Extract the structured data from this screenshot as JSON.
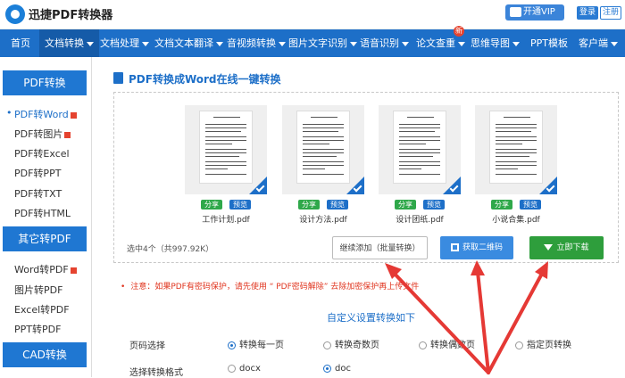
{
  "header": {
    "brand": "迅捷PDF转换器",
    "vip_label": "开通VIP",
    "login_label": "登录",
    "register_label": "注册"
  },
  "nav": {
    "items": [
      {
        "label": "首页",
        "dropdown": false
      },
      {
        "label": "文档转换",
        "dropdown": true,
        "active": true
      },
      {
        "label": "文档处理",
        "dropdown": true
      },
      {
        "label": "文档文本翻译",
        "dropdown": true
      },
      {
        "label": "音视频转换",
        "dropdown": true
      },
      {
        "label": "图片文字识别",
        "dropdown": true
      },
      {
        "label": "语音识别",
        "dropdown": true
      },
      {
        "label": "论文查重",
        "dropdown": true
      },
      {
        "label": "思维导图",
        "dropdown": true
      },
      {
        "label": "PPT模板",
        "dropdown": false
      },
      {
        "label": "客户端",
        "dropdown": true
      }
    ],
    "new_badge": "新"
  },
  "sidebar": {
    "groups": [
      {
        "title": "PDF转换",
        "items": [
          "PDF转Word",
          "PDF转图片",
          "PDF转Excel",
          "PDF转PPT",
          "PDF转TXT",
          "PDF转HTML"
        ]
      },
      {
        "title": "其它转PDF",
        "items": [
          "Word转PDF",
          "图片转PDF",
          "Excel转PDF",
          "PPT转PDF"
        ]
      },
      {
        "title": "CAD转换",
        "items": []
      }
    ]
  },
  "main": {
    "title": "PDF转换成Word在线一键转换",
    "files": [
      {
        "name": "工作计划.pdf",
        "share": "分享",
        "preview": "预览"
      },
      {
        "name": "设计方法.pdf",
        "share": "分享",
        "preview": "预览"
      },
      {
        "name": "设计团纸.pdf",
        "share": "分享",
        "preview": "预览"
      },
      {
        "name": "小说合集.pdf",
        "share": "分享",
        "preview": "预览"
      }
    ],
    "stats": "选中4个（共997.92K）",
    "buttons": {
      "add": "继续添加（批量转换）",
      "qr": "获取二维码",
      "download": "立即下载"
    },
    "notice": {
      "bullet": "•",
      "text": "注意：如果PDF有密码保护，请先使用  “ PDF密码解除”  去除加密保护再上传文件"
    },
    "settings_title": "自定义设置转换如下",
    "page_select": {
      "label": "页码选择",
      "options": [
        "转换每一页",
        "转换奇数页",
        "转换偶数页",
        "指定页转换"
      ],
      "selected": 0
    },
    "format_select": {
      "label": "选择转换格式",
      "options": [
        "docx",
        "doc"
      ],
      "selected": 1
    }
  },
  "colors": {
    "nav": "#1d6fc8",
    "download": "#2e9e3c",
    "qr": "#3a8be0",
    "notice": "#e0341e",
    "arrow": "#e53935"
  }
}
